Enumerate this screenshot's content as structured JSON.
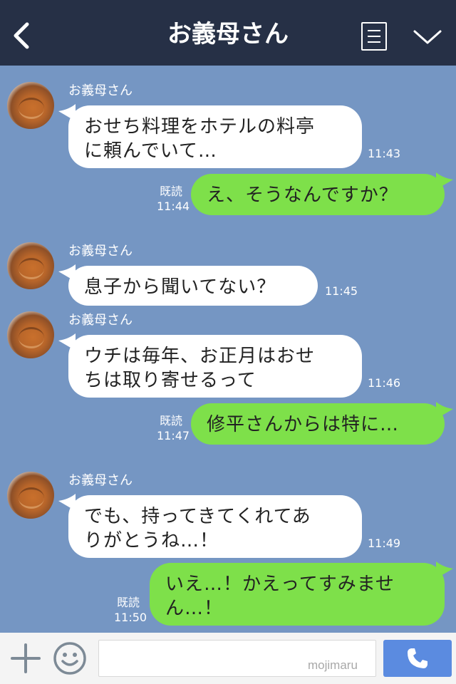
{
  "header": {
    "title": "お義母さん"
  },
  "messages": [
    {
      "type": "in",
      "sender": "お義母さん",
      "lines": [
        "おせち料理をホテルの料亭",
        "に頼んでいて…"
      ],
      "time": "11:43"
    },
    {
      "type": "out",
      "lines": [
        "え、そうなんですか？"
      ],
      "read": "既読",
      "time": "11:44"
    },
    {
      "type": "in",
      "sender": "お義母さん",
      "lines": [
        "息子から聞いてない？"
      ],
      "time": "11:45"
    },
    {
      "type": "in",
      "sender": "お義母さん",
      "lines": [
        "ウチは毎年、お正月はおせ",
        "ちは取り寄せるって"
      ],
      "time": "11:46"
    },
    {
      "type": "out",
      "lines": [
        "修平さんからは特に…"
      ],
      "read": "既読",
      "time": "11:47"
    },
    {
      "type": "in",
      "sender": "お義母さん",
      "lines": [
        "でも、持ってきてくれてあ",
        "りがとうね…！"
      ],
      "time": "11:49"
    },
    {
      "type": "out",
      "lines": [
        "いえ…！かえってすみませ",
        "ん…！"
      ],
      "read": "既読",
      "time": "11:50"
    }
  ],
  "input": {
    "placeholder": "",
    "watermark": "mojimaru"
  },
  "colors": {
    "header_bg": "#263046",
    "chat_bg": "#7596c3",
    "incoming_bubble": "#ffffff",
    "outgoing_bubble": "#7ee04a",
    "send_button": "#5b8be0"
  },
  "icons": {
    "back": "chevron-left-icon",
    "menu": "menu-lines-icon",
    "collapse": "chevron-down-icon",
    "plus": "plus-icon",
    "emoji": "smile-icon",
    "send": "phone-icon"
  }
}
